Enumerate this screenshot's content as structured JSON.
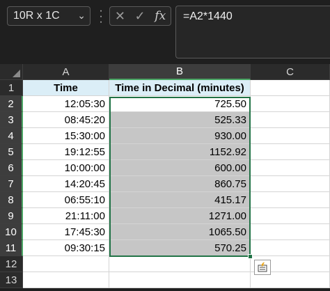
{
  "name_box": {
    "value": "10R x 1C"
  },
  "formula_bar": {
    "formula": "=A2*1440"
  },
  "columns": [
    {
      "label": "A",
      "selected": false
    },
    {
      "label": "B",
      "selected": true
    },
    {
      "label": "C",
      "selected": false
    }
  ],
  "rows": [
    "1",
    "2",
    "3",
    "4",
    "5",
    "6",
    "7",
    "8",
    "9",
    "10",
    "11",
    "12",
    "13"
  ],
  "header_row": {
    "a": "Time",
    "b": "Time in Decimal (minutes)"
  },
  "data": [
    {
      "time": "12:05:30",
      "decimal": "725.50"
    },
    {
      "time": "08:45:20",
      "decimal": "525.33"
    },
    {
      "time": "15:30:00",
      "decimal": "930.00"
    },
    {
      "time": "19:12:55",
      "decimal": "1152.92"
    },
    {
      "time": "10:00:00",
      "decimal": "600.00"
    },
    {
      "time": "14:20:45",
      "decimal": "860.75"
    },
    {
      "time": "06:55:10",
      "decimal": "415.17"
    },
    {
      "time": "21:11:00",
      "decimal": "1271.00"
    },
    {
      "time": "17:45:30",
      "decimal": "1065.50"
    },
    {
      "time": "09:30:15",
      "decimal": "570.25"
    }
  ],
  "icons": {
    "name_box_dropdown": "chevron-down-icon",
    "more_options": "vertical-ellipsis-icon",
    "cancel": "x-icon",
    "enter": "check-icon",
    "insert_function": "fx-icon",
    "quick_analysis": "quick-analysis-icon"
  },
  "colors": {
    "selection_border": "#217346",
    "header_fill": "#dbeef7",
    "selected_fill": "#c6c6c6"
  }
}
